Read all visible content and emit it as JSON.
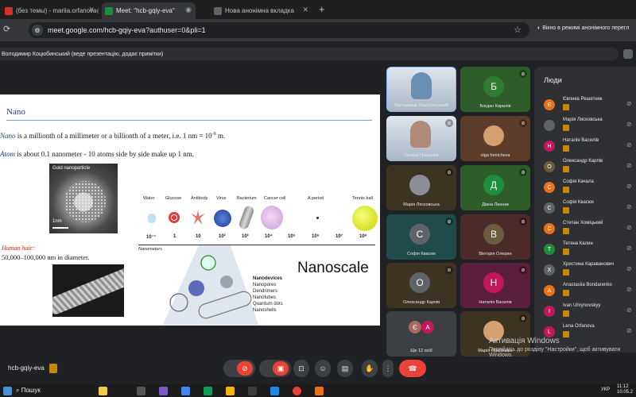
{
  "browser": {
    "tabs": [
      {
        "title": "(без темы) - mariia.orfanova@...",
        "icon_color": "#d93025"
      },
      {
        "title": "Meet: \"hcb-gqiy-eva\"",
        "icon_color": "#1e8e3e"
      },
      {
        "title": "Нова анонімна вкладка",
        "icon_color": "#5f6368"
      }
    ],
    "url": "meet.google.com/hcb-gqiy-eva?authuser=0&pli=1",
    "incognito_label": "Вікно в режимі анонімного перегл"
  },
  "presenter_banner": "Володимир Коцюбинський (веде презентацію, додає примітки)",
  "slide": {
    "title": "Nano",
    "line1_term": "Nano",
    "line1_text": " is a millionth of a millimeter or a billionth of a meter, i.e. 1 nm = 10",
    "line1_exp": "-9",
    "line1_unit": " m.",
    "line2_term": "Atom",
    "line2_text": " is  about 0.1 nanometer - 10 atoms side by side make up 1 nm.",
    "gold_label": "Gold nanoparticle",
    "scale_label": "1nm",
    "hair_label": "Human hair:",
    "hair_text": "50,000–100,000 nm in diameter.",
    "scale_items": [
      "Water",
      "Glucose",
      "Antibody",
      "Virus",
      "Bacterium",
      "Cancer cell",
      "A period",
      "Tennis ball"
    ],
    "scale_exponents": [
      "10⁻¹",
      "1",
      "10",
      "10²",
      "10³",
      "10⁴",
      "10⁵",
      "10⁶",
      "10⁷",
      "10⁸"
    ],
    "nanometers_label": "Nanometers",
    "nanodevices_title": "Nanodevices",
    "nanodevices_items": [
      "Nanopores",
      "Dendrimers",
      "Nanotubes",
      "Quantum dots",
      "Nanoshells"
    ],
    "nanoscale_title": "Nanoscale"
  },
  "tiles": [
    {
      "name": "Володимир Коцюбинський",
      "initial": "",
      "color": "#6b8fb3",
      "video": true
    },
    {
      "name": "Богдан Кирилів",
      "initial": "Б",
      "color": "#2e7d32",
      "bg": "#2f5d2a",
      "video": false
    },
    {
      "name": "Галина Гриценко",
      "initial": "",
      "color": "#b08a78",
      "video": true
    },
    {
      "name": "olga fomicheva",
      "initial": "",
      "color": "#d4a070",
      "bg": "#5d3c2a",
      "video": false
    },
    {
      "name": "Марія Лясковська",
      "initial": "",
      "color": "#8b8f95",
      "bg": "#3d3322",
      "video": false
    },
    {
      "name": "Діана Линник",
      "initial": "Д",
      "color": "#1e8e3e",
      "bg": "#2f5d2a",
      "video": false
    },
    {
      "name": "Софія Квасюк",
      "initial": "С",
      "color": "#5f6368",
      "bg": "#1f4b4b",
      "video": false
    },
    {
      "name": "Вікторія Олерин",
      "initial": "В",
      "color": "#6d5b3e",
      "bg": "#4d2a2a",
      "video": false
    },
    {
      "name": "Олександр Карпів",
      "initial": "О",
      "color": "#5f6368",
      "bg": "#3d3322",
      "video": false
    },
    {
      "name": "Наталія Василів",
      "initial": "Н",
      "color": "#c2185b",
      "bg": "#5a1f3a",
      "video": false
    },
    {
      "name": "Ще 12 осіб",
      "initial": "",
      "color": "#5f6368",
      "bg": "#3c4043",
      "video": false
    },
    {
      "name": "Марія Орфанова",
      "initial": "",
      "color": "#d4a070",
      "bg": "#3d3322",
      "video": false
    }
  ],
  "more_initials": [
    "Є",
    "А"
  ],
  "people_panel": {
    "title": "Люди",
    "list": [
      {
        "name": "Євгеніа Решетняк",
        "initial": "Є",
        "color": "#e8711a"
      },
      {
        "name": "Марія Лясковська",
        "initial": "",
        "color": "#5f6368"
      },
      {
        "name": "Наталія Василів",
        "initial": "Н",
        "color": "#c2185b"
      },
      {
        "name": "Олександр Карпів",
        "initial": "О",
        "color": "#6d5b3e"
      },
      {
        "name": "Софія Качала",
        "initial": "С",
        "color": "#e8711a"
      },
      {
        "name": "Софія Квасюк",
        "initial": "С",
        "color": "#5f6368"
      },
      {
        "name": "Степан Хоміцький",
        "initial": "С",
        "color": "#e8711a"
      },
      {
        "name": "Тетяна Калин",
        "initial": "Т",
        "color": "#1e8e3e"
      },
      {
        "name": "Христина Караванович",
        "initial": "Х",
        "color": "#5f6368"
      },
      {
        "name": "Anastasiia Bondarenko",
        "initial": "A",
        "color": "#e8711a"
      },
      {
        "name": "Ivan Uhrynovskyy",
        "initial": "I",
        "color": "#c2185b"
      },
      {
        "name": "Lena Orfanova",
        "initial": "L",
        "color": "#c2185b"
      }
    ]
  },
  "meeting_code": "hcb-gqiy-eva",
  "watermark": {
    "line1": "Активація Windows",
    "line2": "Перейдіть до розділу \"Настройки\", щоб активувати",
    "line3": "Windows."
  },
  "taskbar": {
    "search": "Пошук",
    "time": "11:12",
    "date": "10.05.2",
    "lang": "УКР"
  }
}
